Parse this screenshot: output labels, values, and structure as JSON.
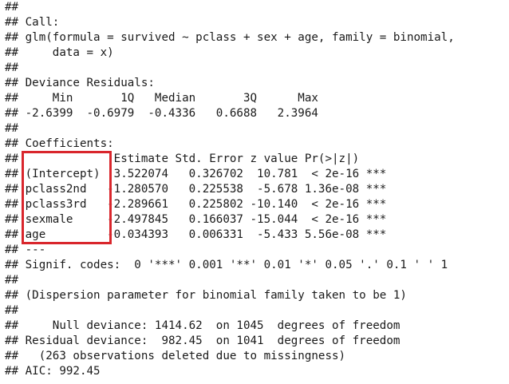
{
  "console": {
    "lines": [
      "## ",
      "## Call:",
      "## glm(formula = survived ~ pclass + sex + age, family = binomial,",
      "##     data = x)",
      "## ",
      "## Deviance Residuals: ",
      "##     Min       1Q   Median       3Q      Max  ",
      "## -2.6399  -0.6979  -0.4336   0.6688   2.3964  ",
      "## ",
      "## Coefficients:",
      "##              Estimate Std. Error z value Pr(>|z|)    ",
      "## (Intercept)  3.522074   0.326702  10.781  < 2e-16 ***",
      "## pclass2nd   -1.280570   0.225538  -5.678 1.36e-08 ***",
      "## pclass3rd   -2.289661   0.225802 -10.140  < 2e-16 ***",
      "## sexmale     -2.497845   0.166037 -15.044  < 2e-16 ***",
      "## age         -0.034393   0.006331  -5.433 5.56e-08 ***",
      "## ---",
      "## Signif. codes:  0 '***' 0.001 '**' 0.01 '*' 0.05 '.' 0.1 ' ' 1",
      "## ",
      "## (Dispersion parameter for binomial family taken to be 1)",
      "## ",
      "##     Null deviance: 1414.62  on 1045  degrees of freedom",
      "## Residual deviance:  982.45  on 1041  degrees of freedom",
      "##   (263 observations deleted due to missingness)",
      "## AIC: 992.45"
    ]
  },
  "highlight": {
    "color": "#d9262c"
  }
}
